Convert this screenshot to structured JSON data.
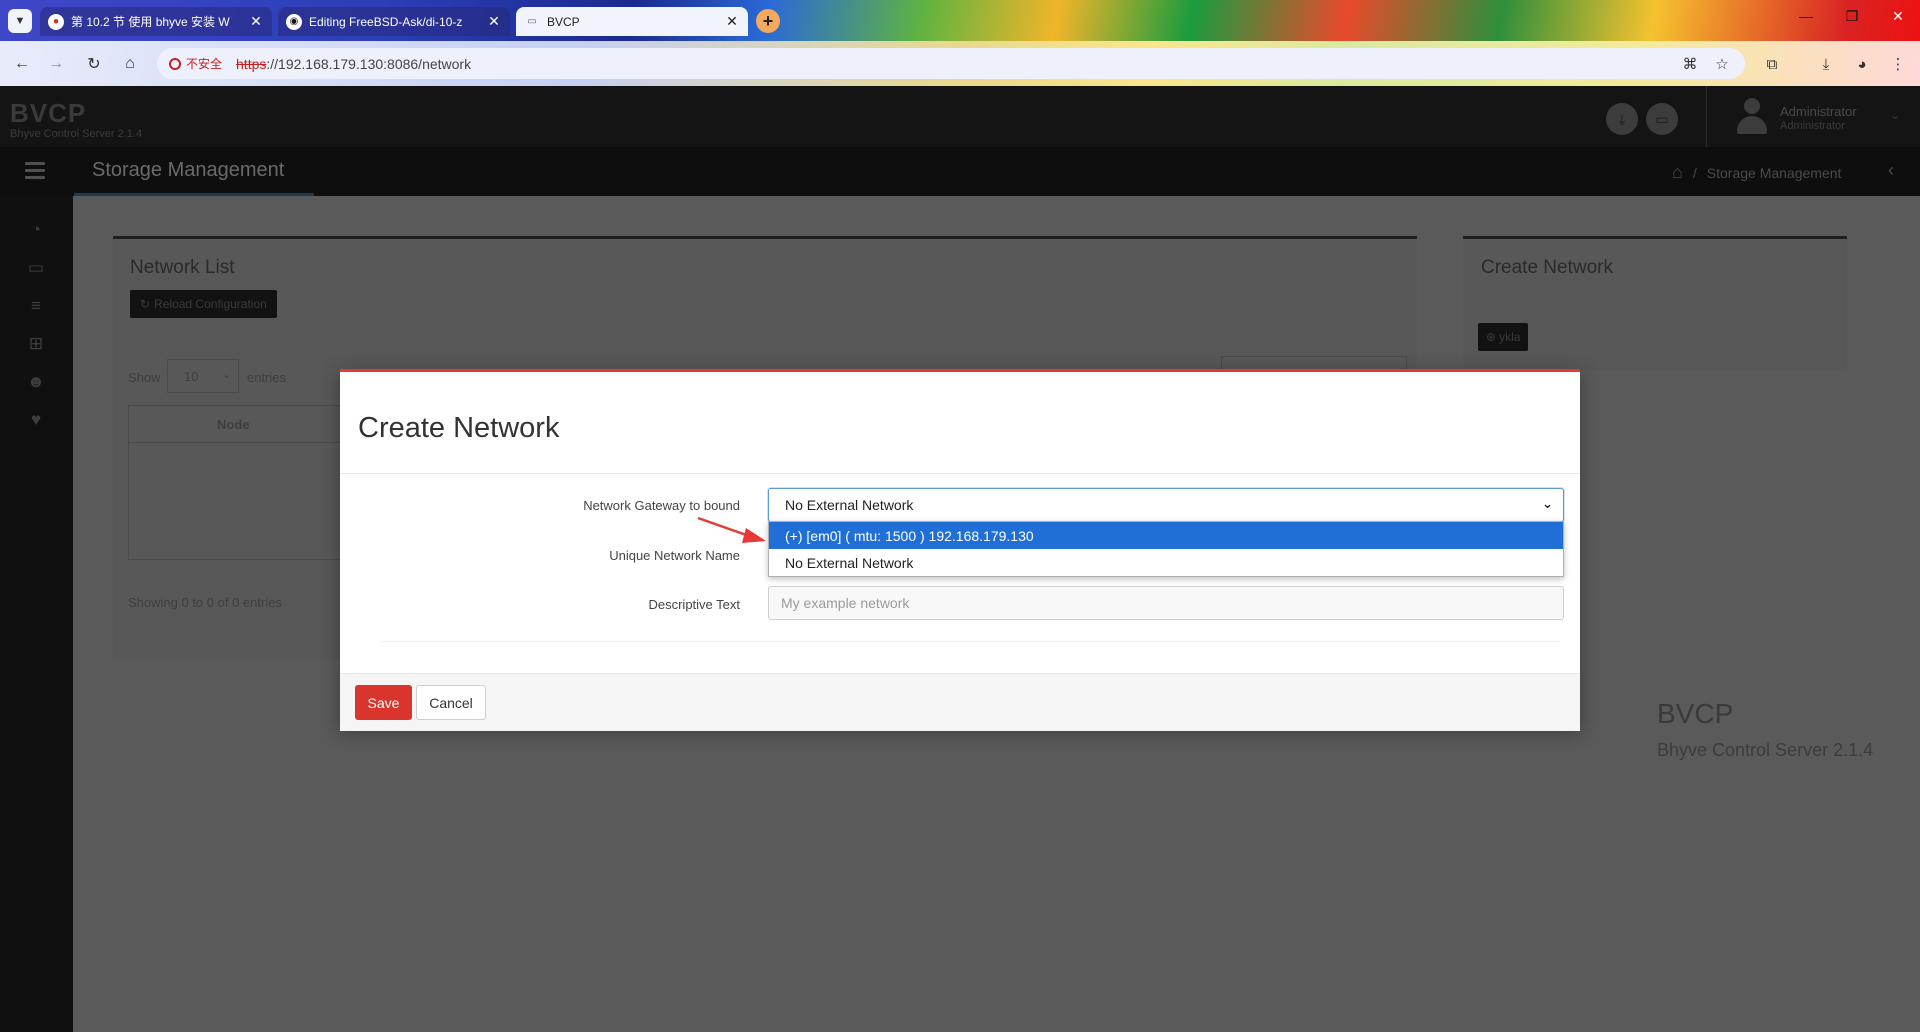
{
  "browser": {
    "tabs": [
      {
        "title": "第 10.2 节 使用 bhyve 安装 W",
        "favicon": "red-circle-icon"
      },
      {
        "title": "Editing FreeBSD-Ask/di-10-z",
        "favicon": "github-icon"
      },
      {
        "title": "BVCP",
        "favicon": "page-icon"
      }
    ],
    "security_label": "不安全",
    "url_scheme": "https",
    "url_rest": "://192.168.179.130:8086/network"
  },
  "app": {
    "logo": "BVCP",
    "logo_sub": "Bhyve Control Server 2.1.4",
    "user_name": "Administrator",
    "user_role": "Administrator",
    "page_title": "Storage Management",
    "breadcrumb": "Storage Management"
  },
  "network_list": {
    "title": "Network List",
    "reload_label": "Reload Configuration",
    "show_label": "Show",
    "show_value": "10",
    "entries_label": "entries",
    "col_node": "Node",
    "showing": "Showing 0 to 0 of 0 entries"
  },
  "create_panel": {
    "title": "Create Network",
    "button_label": "ykla"
  },
  "footer_brand": {
    "name": "BVCP",
    "version": "Bhyve Control Server 2.1.4"
  },
  "modal": {
    "title": "Create Network",
    "gateway_label": "Network Gateway to bound",
    "gateway_value": "No External Network",
    "name_label": "Unique Network Name",
    "desc_label": "Descriptive Text",
    "desc_placeholder": "My example network",
    "save_label": "Save",
    "cancel_label": "Cancel",
    "options": [
      "(+) [em0] ( mtu: 1500 ) 192.168.179.130",
      "No External Network"
    ]
  },
  "colors": {
    "accent_red": "#d9352c",
    "select_highlight": "#1f6fd6"
  }
}
